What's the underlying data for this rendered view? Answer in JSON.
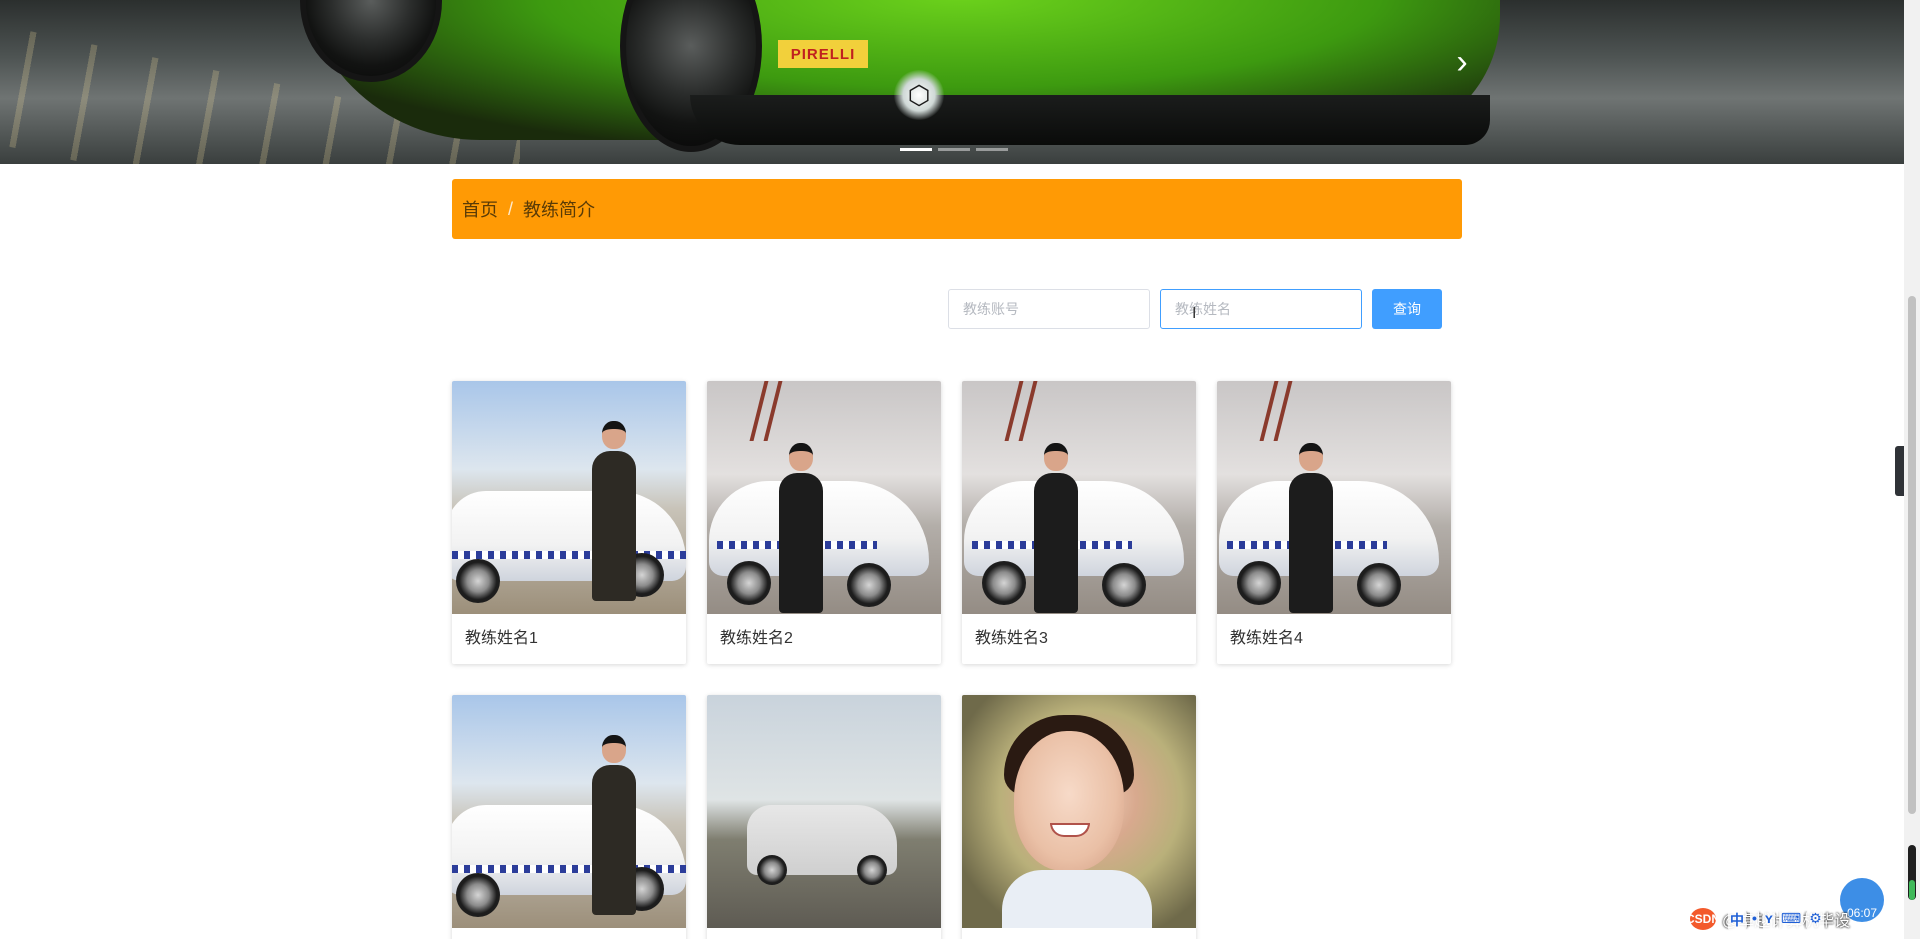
{
  "banner": {
    "brand_sticker": "PIRELLI",
    "next_arrow": "›",
    "slides": 3,
    "active_slide": 1
  },
  "breadcrumb": {
    "home": "首页",
    "separator": "/",
    "current": "教练简介"
  },
  "search": {
    "account_placeholder": "教练账号",
    "name_placeholder": "教练姓名",
    "button_label": "查询"
  },
  "coaches": [
    {
      "name": "教练姓名1",
      "photo": "coach-by-training-car"
    },
    {
      "name": "教练姓名2",
      "photo": "coach-with-fleet"
    },
    {
      "name": "教练姓名3",
      "photo": "coach-with-fleet"
    },
    {
      "name": "教练姓名4",
      "photo": "coach-with-fleet"
    },
    {
      "name": "",
      "photo": "coach-by-training-car"
    },
    {
      "name": "",
      "photo": "old-white-sedan"
    },
    {
      "name": "",
      "photo": "smiling-woman"
    }
  ],
  "side_tab": {
    "icon": "chevron-left-icon",
    "glyph": "‹"
  },
  "overlay": {
    "clock": "06:07",
    "watermark_icon": "CSDN",
    "watermark_text": "@卓越计算机毕设",
    "ime_items": [
      "中",
      "•",
      "ʏ",
      "⌨",
      "⚙"
    ]
  },
  "colors": {
    "breadcrumb_bg": "#ff9a05",
    "primary_button": "#409eff"
  }
}
